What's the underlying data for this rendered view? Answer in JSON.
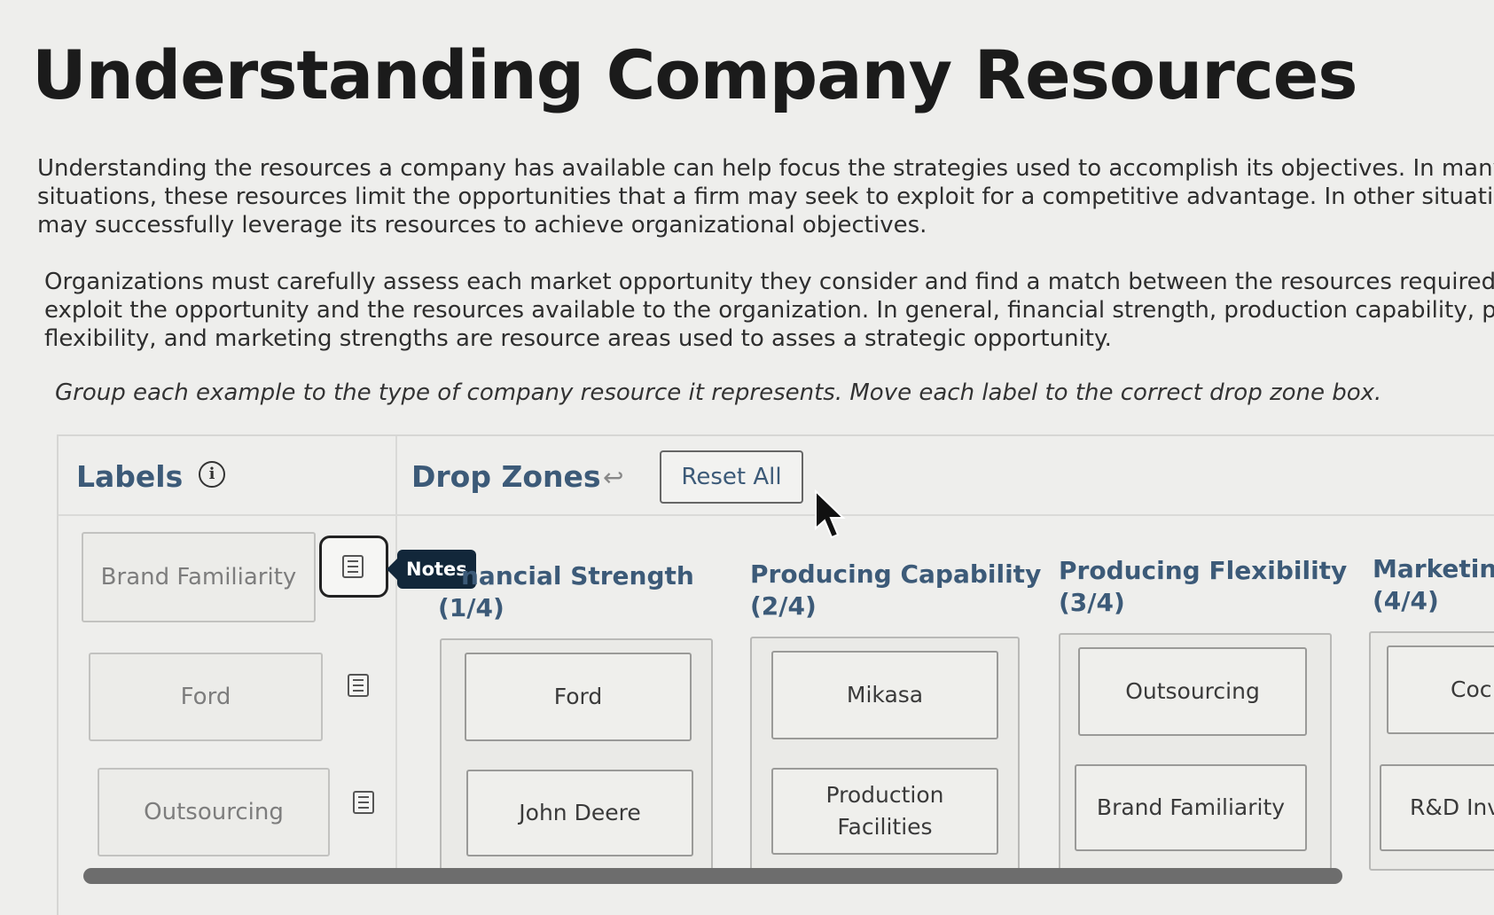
{
  "title": "Understanding Company Resources",
  "paragraph1": [
    "Understanding the resources a company has available can help focus the strategies used to accomplish its objectives. In many",
    "situations, these resources limit the opportunities that a firm may seek to exploit for a competitive advantage. In other situations, a f",
    "may successfully leverage its resources to achieve organizational objectives."
  ],
  "paragraph2": [
    "Organizations must carefully assess each market opportunity they consider and find a match between the resources required to",
    "exploit the opportunity and the resources available to the organization. In general, financial strength, production capability, producti",
    "flexibility, and marketing strengths are resource areas used to asses a strategic opportunity."
  ],
  "instruction": "Group each example to the type of company resource it represents. Move each label to the correct drop zone box.",
  "labels_header": "Labels",
  "info_icon": "i",
  "drop_zones_header": "Drop Zones",
  "back_icon": "↩",
  "reset_label": "Reset All",
  "tooltip": "Notes",
  "label_cards": [
    {
      "text": "Brand Familiarity"
    },
    {
      "text": "Ford"
    },
    {
      "text": "Outsourcing"
    }
  ],
  "zones": [
    {
      "title": "nancial Strength",
      "count": "(1/4)",
      "items": [
        "Ford",
        "John Deere"
      ]
    },
    {
      "title": "Producing Capability",
      "count": "(2/4)",
      "items": [
        "Mikasa",
        "Production Facilities"
      ]
    },
    {
      "title": "Producing Flexibility",
      "count": "(3/4)",
      "items": [
        "Outsourcing",
        "Brand Familiarity"
      ]
    },
    {
      "title": "Marketing",
      "count": "(4/4)",
      "items": [
        "Coc",
        "R&D Inv"
      ]
    }
  ]
}
